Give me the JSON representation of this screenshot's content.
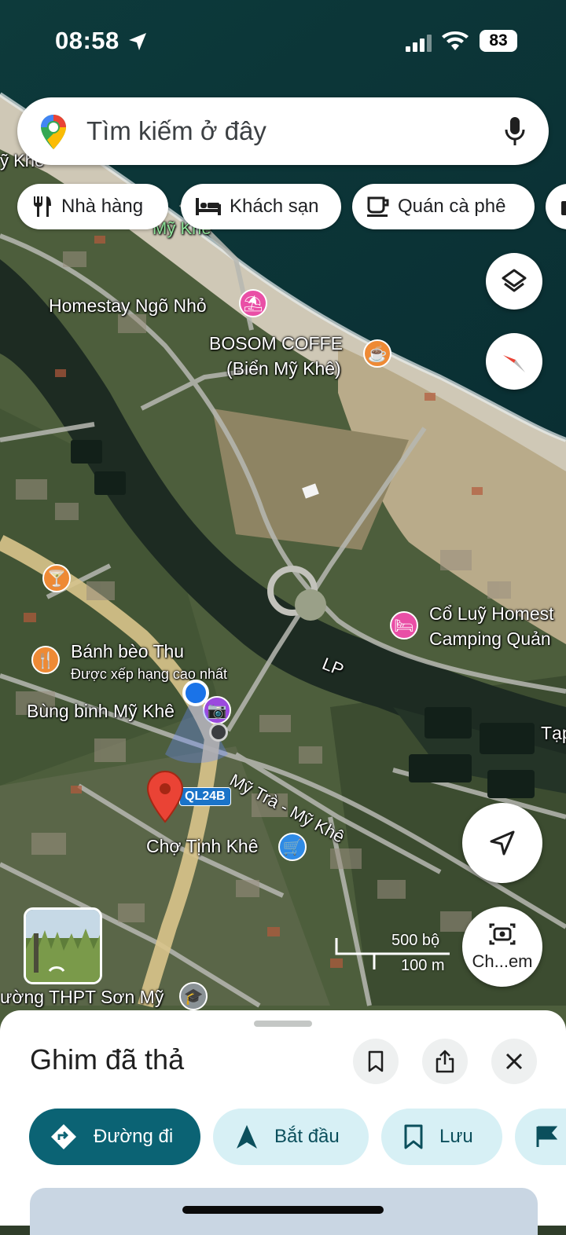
{
  "status_bar": {
    "time": "08:58",
    "battery": "83"
  },
  "search": {
    "placeholder": "Tìm kiếm ở đây"
  },
  "chips": [
    {
      "label": "Nhà hàng",
      "icon": "fork-knife-icon"
    },
    {
      "label": "Khách sạn",
      "icon": "bed-icon"
    },
    {
      "label": "Quán cà phê",
      "icon": "coffee-cup-icon"
    }
  ],
  "map": {
    "labels": {
      "my_khe_top": "Mỹ Khê",
      "homestay": "Homestay Ngõ Nhỏ",
      "bosom_line1": "BOSOM COFFE",
      "bosom_line2": "(Biển Mỹ Khê)",
      "co_luy_line1": "Cổ Luỹ Homest",
      "co_luy_line2": "Camping Quản",
      "lp": "LP",
      "tap": "Tạp",
      "banh_beo": "Bánh bèo Thu",
      "banh_beo_sub": "Được xếp hạng cao nhất",
      "bung_binh": "Bùng binh Mỹ Khê",
      "road": "Mỹ Trà - Mỹ Khê",
      "ql24b": "QL24B",
      "cho_tinh_khe": "Chợ Tịnh Khê",
      "thpt": "ường THPT Sơn Mỹ",
      "top_left_fragment": "ỹ Khê",
      "khe_fragment": "Ki"
    },
    "scale": {
      "imperial": "500 bộ",
      "metric": "100 m"
    },
    "camera_button_label": "Ch...em"
  },
  "sheet": {
    "title": "Ghim đã thả",
    "actions": [
      {
        "label": "Đường đi",
        "style": "primary"
      },
      {
        "label": "Bắt đầu",
        "style": "secondary"
      },
      {
        "label": "Lưu",
        "style": "secondary"
      }
    ]
  },
  "colors": {
    "primary_button": "#0b6374",
    "secondary_button": "#d7f0f5",
    "pin_red": "#ea4335",
    "poi_pink": "#e94fa6",
    "poi_orange": "#ee8a35",
    "poi_blue": "#2f8be6",
    "poi_purple": "#9b49de"
  }
}
